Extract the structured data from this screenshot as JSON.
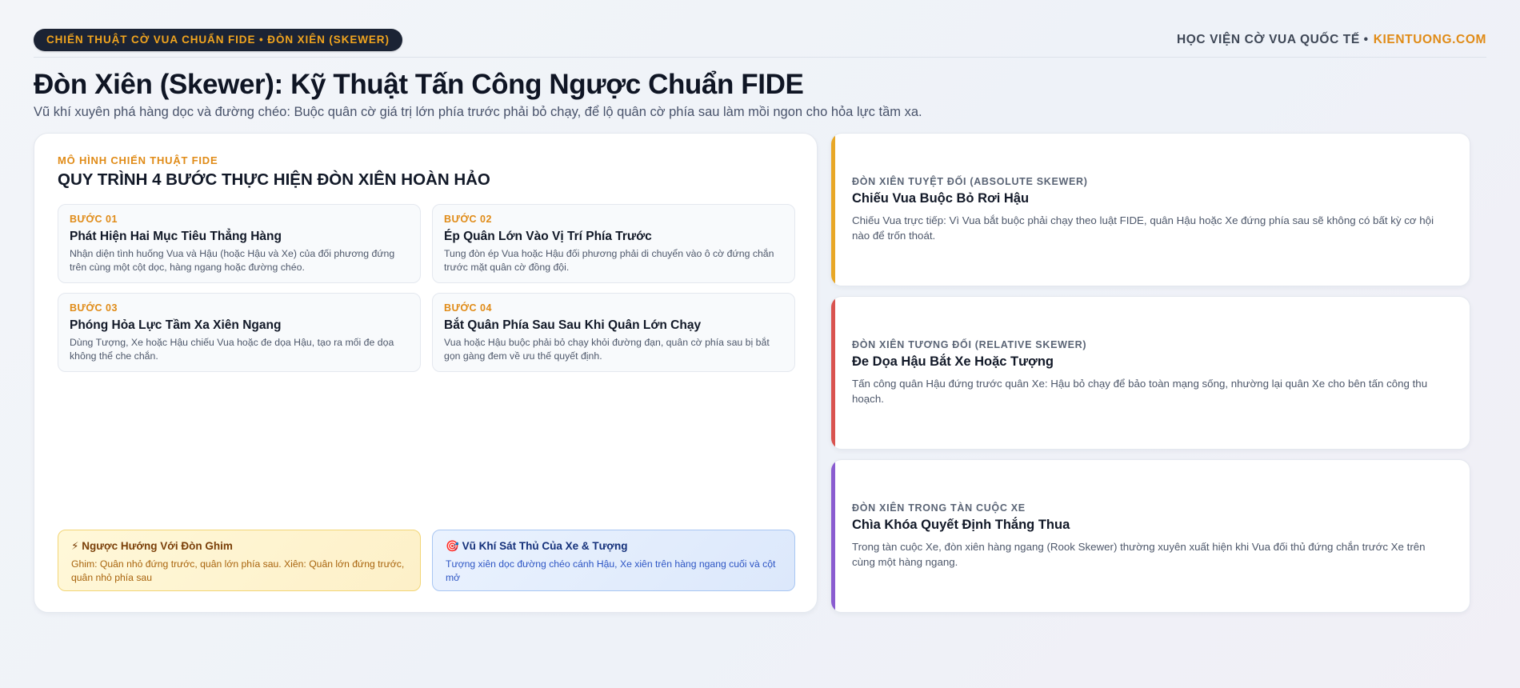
{
  "header": {
    "badge": "CHIẾN THUẬT CỜ VUA CHUẨN FIDE • ĐÒN XIÊN (SKEWER)",
    "brand_name": "HỌC VIỆN CỜ VUA QUỐC TẾ •",
    "brand_site": "KIENTUONG.COM"
  },
  "page": {
    "title": "Đòn Xiên (Skewer): Kỹ Thuật Tấn Công Ngược Chuẩn FIDE",
    "subtitle": "Vũ khí xuyên phá hàng dọc và đường chéo: Buộc quân cờ giá trị lớn phía trước phải bỏ chạy, để lộ quân cờ phía sau làm mồi ngon cho hỏa lực tầm xa."
  },
  "model": {
    "eyebrow": "MÔ HÌNH CHIẾN THUẬT FIDE",
    "title": "QUY TRÌNH 4 BƯỚC THỰC HIỆN ĐÒN XIÊN HOÀN HẢO",
    "steps": [
      {
        "num": "BƯỚC 01",
        "name": "Phát Hiện Hai Mục Tiêu Thẳng Hàng",
        "desc": "Nhận diện tình huống Vua và Hậu (hoặc Hậu và Xe) của đối phương đứng trên cùng một cột dọc, hàng ngang hoặc đường chéo."
      },
      {
        "num": "BƯỚC 02",
        "name": "Ép Quân Lớn Vào Vị Trí Phía Trước",
        "desc": "Tung đòn ép Vua hoặc Hậu đối phương phải di chuyển vào ô cờ đứng chắn trước mặt quân cờ đồng đội."
      },
      {
        "num": "BƯỚC 03",
        "name": "Phóng Hỏa Lực Tầm Xa Xiên Ngang",
        "desc": "Dùng Tượng, Xe hoặc Hậu chiếu Vua hoặc đe dọa Hậu, tạo ra mối đe dọa không thể che chắn."
      },
      {
        "num": "BƯỚC 04",
        "name": "Bắt Quân Phía Sau Sau Khi Quân Lớn Chạy",
        "desc": "Vua hoặc Hậu buộc phải bỏ chạy khỏi đường đạn, quân cờ phía sau bị bắt gọn gàng đem về ưu thế quyết định."
      }
    ],
    "notes": [
      {
        "icon": "⚡",
        "title": "Ngược Hướng Với Đòn Ghim",
        "desc": "Ghim: Quân nhỏ đứng trước, quân lớn phía sau. Xiên: Quân lớn đứng trước, quân nhỏ phía sau"
      },
      {
        "icon": "🎯",
        "title": "Vũ Khí Sát Thủ Của Xe & Tượng",
        "desc": "Tượng xiên dọc đường chéo cánh Hậu, Xe xiên trên hàng ngang cuối và cột mở"
      }
    ]
  },
  "cards": [
    {
      "kicker": "ĐÒN XIÊN TUYỆT ĐỐI (ABSOLUTE SKEWER)",
      "title": "Chiếu Vua Buộc Bỏ Rơi Hậu",
      "desc": "Chiếu Vua trực tiếp: Vì Vua bắt buộc phải chạy theo luật FIDE, quân Hậu hoặc Xe đứng phía sau sẽ không có bất kỳ cơ hội nào để trốn thoát.",
      "accent": "#e8a726"
    },
    {
      "kicker": "ĐÒN XIÊN TƯƠNG ĐỐI (RELATIVE SKEWER)",
      "title": "Đe Dọa Hậu Bắt Xe Hoặc Tượng",
      "desc": "Tấn công quân Hậu đứng trước quân Xe: Hậu bỏ chạy để bảo toàn mạng sống, nhường lại quân Xe cho bên tấn công thu hoạch.",
      "accent": "#d9534f"
    },
    {
      "kicker": "ĐÒN XIÊN TRONG TÀN CUỘC XE",
      "title": "Chìa Khóa Quyết Định Thắng Thua",
      "desc": "Trong tàn cuộc Xe, đòn xiên hàng ngang (Rook Skewer) thường xuyên xuất hiện khi Vua đối thủ đứng chắn trước Xe trên cùng một hàng ngang.",
      "accent": "#8a5cd0"
    }
  ]
}
